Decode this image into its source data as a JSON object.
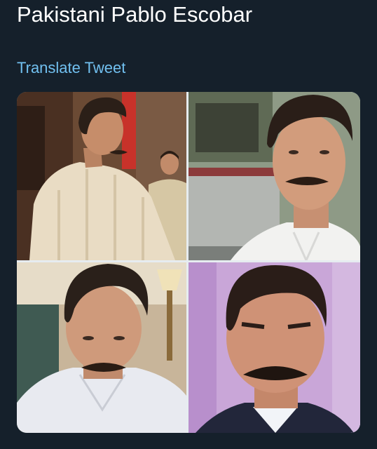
{
  "tweet": {
    "text": "Pakistani Pablo Escobar",
    "translate_label": "Translate Tweet"
  },
  "media": {
    "photos": [
      {
        "alt": "photo-1"
      },
      {
        "alt": "photo-2"
      },
      {
        "alt": "photo-3"
      },
      {
        "alt": "photo-4"
      }
    ]
  },
  "colors": {
    "background": "#15202b",
    "text": "#ffffff",
    "link": "#71c0f0"
  }
}
